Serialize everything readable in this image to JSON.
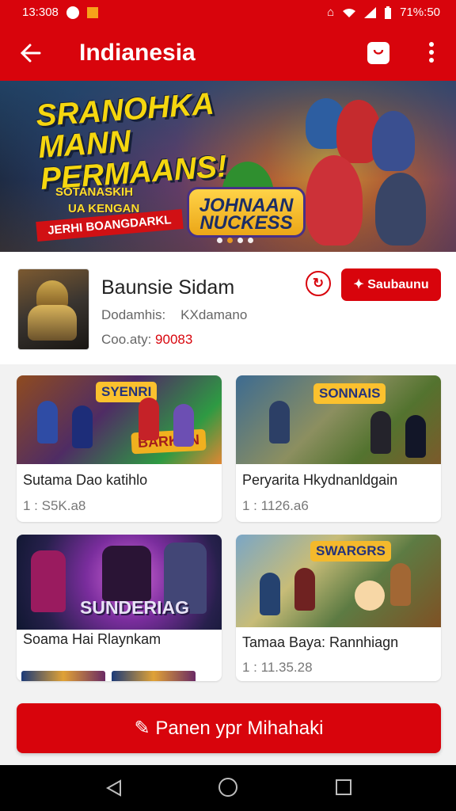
{
  "status_bar": {
    "time": "13:308",
    "right_text": "71%:50",
    "color": "#d8040c"
  },
  "app_bar": {
    "title": "Indianesia",
    "back_icon": "arrow-left-icon",
    "bag_icon": "shopping-bag-icon",
    "more_icon": "more-vert-icon"
  },
  "banner": {
    "headline": "SRANOHKA MANN PERMAANS!",
    "sub1": "SOTANASKIH",
    "sub2": "UA KENGAN",
    "label": "JERHI BOANGDARKL",
    "logo": "JOHNAAN NUCKESS",
    "slides": 4,
    "active_slide": 2
  },
  "profile": {
    "name": "Baunsie Sidam",
    "meta_label": "Dodamhis:",
    "meta_value": "KXdamano",
    "count_label": "Coo.aty:",
    "count_value": "90083",
    "action_icon": "share-icon",
    "follow_label": "Saubaunu",
    "follow_icon": "twitter-icon"
  },
  "cards": [
    {
      "title": "Sutama Dao katihlo",
      "stats": "1 : S5K.a8",
      "badge": "SYENRI",
      "art_text": "BARKAN"
    },
    {
      "title": "Peryarita Hkydnanldgain",
      "stats": "1 : 1126.a6",
      "badge": "SONNAIS"
    },
    {
      "title": "Soama Hai Rlaynkam",
      "art_text": "SUNDERIAG"
    },
    {
      "title": "Tamaa Baya: Rannhiagn",
      "stats": "1 : 11.35.28",
      "badge": "SWARGRS"
    }
  ],
  "primary_action": {
    "label": "Panen ypr Mihahaki",
    "icon": "edit-icon"
  },
  "system_nav": {
    "back_icon": "back-triangle-icon",
    "home_icon": "home-circle-icon",
    "recent_icon": "recent-square-icon"
  }
}
